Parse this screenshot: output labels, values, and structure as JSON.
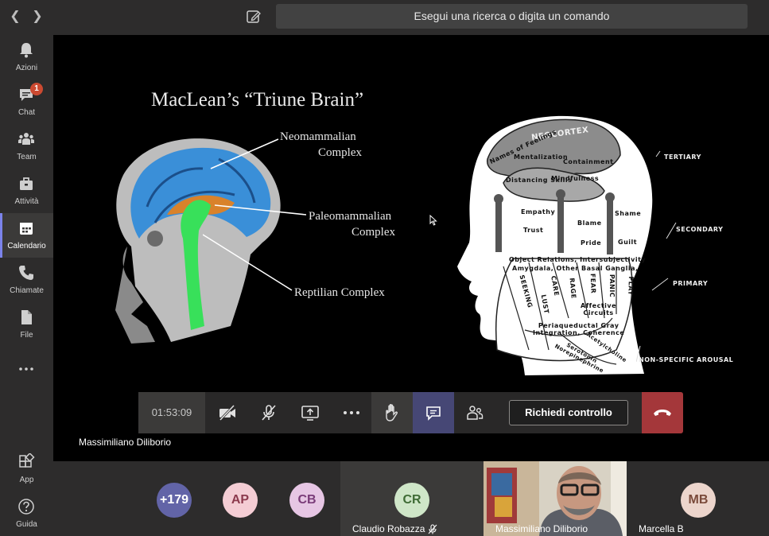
{
  "search": {
    "placeholder": "Esegui una ricerca o digita un comando"
  },
  "rail": {
    "items": [
      {
        "label": "Azioni"
      },
      {
        "label": "Chat",
        "badge": "1"
      },
      {
        "label": "Team"
      },
      {
        "label": "Attività"
      },
      {
        "label": "Calendario"
      },
      {
        "label": "Chiamate"
      },
      {
        "label": "File"
      },
      {
        "label": "App"
      },
      {
        "label": "Guida"
      }
    ]
  },
  "slide": {
    "title": "MacLean’s “Triune Brain”",
    "left_labels": {
      "neomammalian": [
        "Neomammalian",
        "Complex"
      ],
      "paleomammalian": [
        "Paleomammalian",
        "Complex"
      ],
      "reptilian": "Reptilian Complex"
    },
    "head": {
      "neocortex": "NEOCORTEX",
      "words": [
        "Names of Feelings",
        "Mentalization",
        "Containment",
        "Distancing Skills",
        "Mindfulness",
        "Empathy",
        "Blame",
        "Shame",
        "Trust",
        "Pride",
        "Guilt"
      ],
      "object_relations": "Object Relations, Intersubjectivity",
      "amygdala": "Amygdala, Other Basal Ganglia,",
      "circuits": [
        "SEEKING",
        "LUST",
        "CARE",
        "RAGE",
        "FEAR",
        "PANIC",
        "PLAY"
      ],
      "affective": [
        "Affective",
        "Circuits"
      ],
      "periaqueductal": [
        "Periaqueductal Gray",
        "Integration, Coherence"
      ],
      "neuro": [
        "Acetylcholine",
        "Serotonin",
        "Norepinephrine"
      ]
    },
    "levels": [
      "TERTIARY",
      "SECONDARY",
      "PRIMARY",
      "NON-SPECIFIC AROUSAL"
    ]
  },
  "callbar": {
    "timer": "01:53:09",
    "request_control": "Richiedi controllo"
  },
  "presenter": {
    "name": "Massimiliano Diliborio"
  },
  "participants": {
    "overflow": "+179",
    "avatars": [
      {
        "initials": "AP",
        "bg": "#f4cdd4",
        "fg": "#8c3a4d"
      },
      {
        "initials": "CB",
        "bg": "#e6c6e4",
        "fg": "#7a3c79"
      },
      {
        "initials": "CR",
        "bg": "#cfe6c8",
        "fg": "#3f6b35"
      },
      {
        "initials": "MB",
        "bg": "#ecd5cc",
        "fg": "#7a4a3a"
      }
    ],
    "tiles": [
      {
        "name": "Claudio Robazza"
      },
      {
        "name": "Massimiliano Diliborio"
      },
      {
        "name": "Marcella B"
      }
    ]
  },
  "colors": {
    "accent": "#7b83eb",
    "hangup": "#a4373a",
    "badge": "#cc4a31",
    "overflow": "#6264a7"
  }
}
